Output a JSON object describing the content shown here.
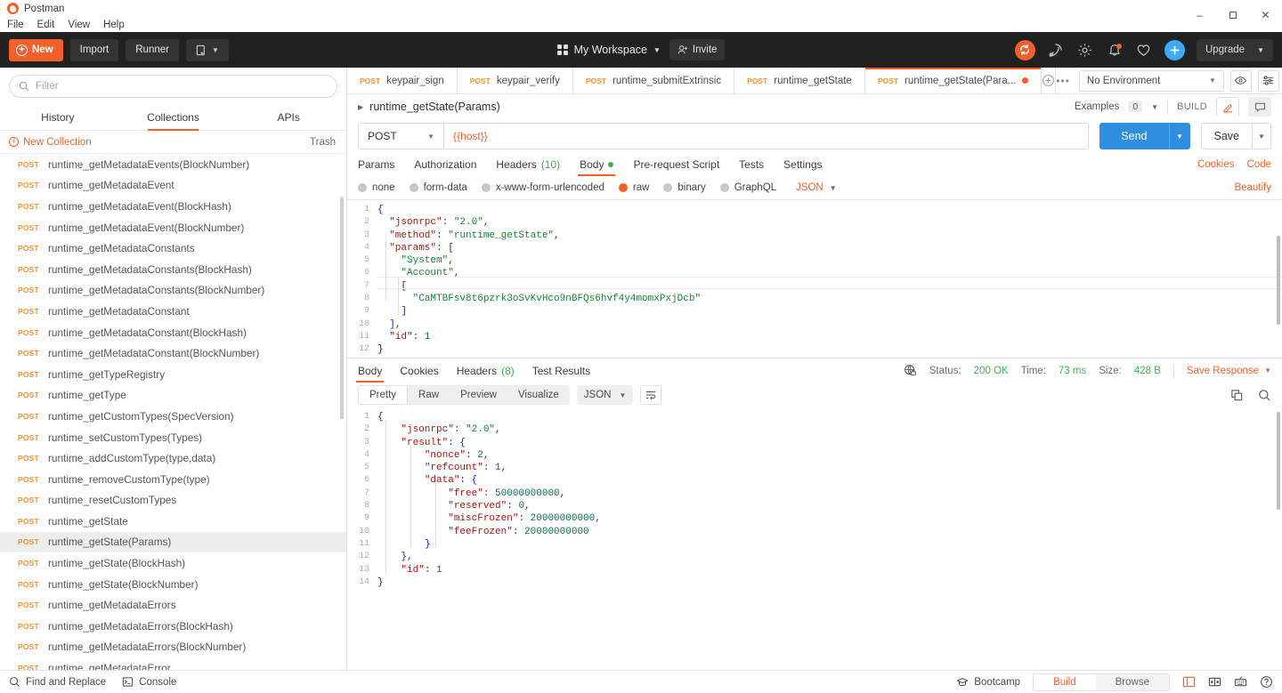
{
  "window": {
    "app_title": "Postman",
    "menu": [
      "File",
      "Edit",
      "View",
      "Help"
    ],
    "controls": {
      "minimize": "–",
      "maximize": "❐",
      "close": "✕"
    }
  },
  "header": {
    "new_label": "New",
    "import_label": "Import",
    "runner_label": "Runner",
    "workspace_label": "My Workspace",
    "invite_label": "Invite",
    "upgrade_label": "Upgrade",
    "icons": [
      "sync-icon",
      "satellite-icon",
      "gear-icon",
      "bell-icon",
      "heart-icon",
      "plus-icon"
    ]
  },
  "sidebar": {
    "filter_placeholder": "Filter",
    "filter_value": "",
    "tabs": [
      {
        "label": "History",
        "active": false
      },
      {
        "label": "Collections",
        "active": true
      },
      {
        "label": "APIs",
        "active": false
      }
    ],
    "new_collection_label": "New Collection",
    "trash_label": "Trash",
    "method": "POST",
    "requests": [
      {
        "name": "runtime_getMetadataEvents(BlockNumber)",
        "selected": false
      },
      {
        "name": "runtime_getMetadataEvent",
        "selected": false
      },
      {
        "name": "runtime_getMetadataEvent(BlockHash)",
        "selected": false
      },
      {
        "name": "runtime_getMetadataEvent(BlockNumber)",
        "selected": false
      },
      {
        "name": "runtime_getMetadataConstants",
        "selected": false
      },
      {
        "name": "runtime_getMetadataConstants(BlockHash)",
        "selected": false
      },
      {
        "name": "runtime_getMetadataConstants(BlockNumber)",
        "selected": false
      },
      {
        "name": "runtime_getMetadataConstant",
        "selected": false
      },
      {
        "name": "runtime_getMetadataConstant(BlockHash)",
        "selected": false
      },
      {
        "name": "runtime_getMetadataConstant(BlockNumber)",
        "selected": false
      },
      {
        "name": "runtime_getTypeRegistry",
        "selected": false
      },
      {
        "name": "runtime_getType",
        "selected": false
      },
      {
        "name": "runtime_getCustomTypes(SpecVersion)",
        "selected": false
      },
      {
        "name": "runtime_setCustomTypes(Types)",
        "selected": false
      },
      {
        "name": "runtime_addCustomType(type,data)",
        "selected": false
      },
      {
        "name": "runtime_removeCustomType(type)",
        "selected": false
      },
      {
        "name": "runtime_resetCustomTypes",
        "selected": false
      },
      {
        "name": "runtime_getState",
        "selected": false
      },
      {
        "name": "runtime_getState(Params)",
        "selected": true
      },
      {
        "name": "runtime_getState(BlockHash)",
        "selected": false
      },
      {
        "name": "runtime_getState(BlockNumber)",
        "selected": false
      },
      {
        "name": "runtime_getMetadataErrors",
        "selected": false
      },
      {
        "name": "runtime_getMetadataErrors(BlockHash)",
        "selected": false
      },
      {
        "name": "runtime_getMetadataErrors(BlockNumber)",
        "selected": false
      },
      {
        "name": "runtime_getMetadataError",
        "selected": false
      }
    ]
  },
  "tabstrip": {
    "tabs": [
      {
        "method": "POST",
        "name": "keypair_sign",
        "active": false,
        "unsaved": false
      },
      {
        "method": "POST",
        "name": "keypair_verify",
        "active": false,
        "unsaved": false
      },
      {
        "method": "POST",
        "name": "runtime_submitExtrinsic",
        "active": false,
        "unsaved": false
      },
      {
        "method": "POST",
        "name": "runtime_getState",
        "active": false,
        "unsaved": false
      },
      {
        "method": "POST",
        "name": "runtime_getState(Para...",
        "active": true,
        "unsaved": true
      }
    ],
    "environment": "No Environment"
  },
  "request_header": {
    "title": "runtime_getState(Params)",
    "examples_label": "Examples",
    "examples_count": "0",
    "build_label": "BUILD"
  },
  "url_bar": {
    "method": "POST",
    "url": "{{host}}",
    "send_label": "Send",
    "save_label": "Save"
  },
  "request_tabs": {
    "items": [
      {
        "label": "Params",
        "active": false,
        "count": ""
      },
      {
        "label": "Authorization",
        "active": false,
        "count": ""
      },
      {
        "label": "Headers",
        "active": false,
        "count": "(10)"
      },
      {
        "label": "Body",
        "active": true,
        "count": ""
      },
      {
        "label": "Pre-request Script",
        "active": false,
        "count": ""
      },
      {
        "label": "Tests",
        "active": false,
        "count": ""
      },
      {
        "label": "Settings",
        "active": false,
        "count": ""
      }
    ],
    "cookies_label": "Cookies",
    "code_label": "Code"
  },
  "body_modes": {
    "options": [
      {
        "label": "none",
        "selected": false
      },
      {
        "label": "form-data",
        "selected": false
      },
      {
        "label": "x-www-form-urlencoded",
        "selected": false
      },
      {
        "label": "raw",
        "selected": true
      },
      {
        "label": "binary",
        "selected": false
      },
      {
        "label": "GraphQL",
        "selected": false
      }
    ],
    "format": "JSON",
    "beautify_label": "Beautify"
  },
  "request_body": {
    "lines": [
      {
        "n": "1",
        "t": "{"
      },
      {
        "n": "2",
        "t": "  \"jsonrpc\": \"2.0\","
      },
      {
        "n": "3",
        "t": "  \"method\": \"runtime_getState\","
      },
      {
        "n": "4",
        "t": "  \"params\": ["
      },
      {
        "n": "5",
        "t": "    \"System\","
      },
      {
        "n": "6",
        "t": "    \"Account\","
      },
      {
        "n": "7",
        "t": "    ["
      },
      {
        "n": "8",
        "t": "      \"CaMTBFsv8t6pzrk3oSvKvHco9nBFQs6hvf4y4momxPxjDcb\""
      },
      {
        "n": "9",
        "t": "    ]"
      },
      {
        "n": "10",
        "t": "  ],"
      },
      {
        "n": "11",
        "t": "  \"id\": 1"
      },
      {
        "n": "12",
        "t": "}"
      }
    ]
  },
  "response": {
    "tabs": [
      {
        "label": "Body",
        "active": true,
        "count": ""
      },
      {
        "label": "Cookies",
        "active": false,
        "count": ""
      },
      {
        "label": "Headers",
        "active": false,
        "count": "(8)"
      },
      {
        "label": "Test Results",
        "active": false,
        "count": ""
      }
    ],
    "status_label": "Status:",
    "status_value": "200 OK",
    "time_label": "Time:",
    "time_value": "73 ms",
    "size_label": "Size:",
    "size_value": "428 B",
    "save_response_label": "Save Response",
    "views": [
      {
        "label": "Pretty",
        "active": true
      },
      {
        "label": "Raw",
        "active": false
      },
      {
        "label": "Preview",
        "active": false
      },
      {
        "label": "Visualize",
        "active": false
      }
    ],
    "format": "JSON",
    "body_lines": [
      {
        "n": "1",
        "t": "{"
      },
      {
        "n": "2",
        "t": "    \"jsonrpc\": \"2.0\","
      },
      {
        "n": "3",
        "t": "    \"result\": {"
      },
      {
        "n": "4",
        "t": "        \"nonce\": 2,"
      },
      {
        "n": "5",
        "t": "        \"refcount\": 1,"
      },
      {
        "n": "6",
        "t": "        \"data\": {"
      },
      {
        "n": "7",
        "t": "            \"free\": 50000000000,"
      },
      {
        "n": "8",
        "t": "            \"reserved\": 0,"
      },
      {
        "n": "9",
        "t": "            \"miscFrozen\": 20000000000,"
      },
      {
        "n": "10",
        "t": "            \"feeFrozen\": 20000000000"
      },
      {
        "n": "11",
        "t": "        }"
      },
      {
        "n": "12",
        "t": "    },"
      },
      {
        "n": "13",
        "t": "    \"id\": 1"
      },
      {
        "n": "14",
        "t": "}"
      }
    ]
  },
  "footer": {
    "find_replace_label": "Find and Replace",
    "console_label": "Console",
    "bootcamp_label": "Bootcamp",
    "build_label": "Build",
    "browse_label": "Browse"
  },
  "colors": {
    "accent": "#f0602b",
    "method": "#f0932b",
    "success": "#3fae5a",
    "send": "#2e8fe0",
    "header_bg": "#212121"
  }
}
